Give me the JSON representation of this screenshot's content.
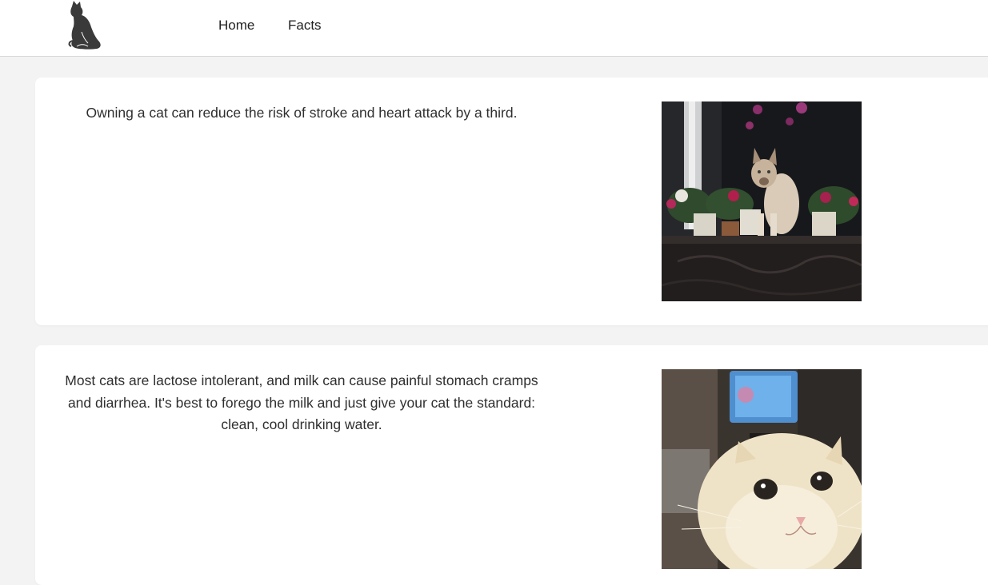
{
  "nav": {
    "home_label": "Home",
    "facts_label": "Facts",
    "logo_icon": "cat-silhouette-icon"
  },
  "facts": [
    {
      "text": "Owning a cat can reduce the risk of stroke and heart attack by a third.",
      "image": "siamese-cat-on-sofa-photo"
    },
    {
      "text": "Most cats are lactose intolerant, and milk can cause painful stomach cramps and diarrhea. It's best to forego the milk and just give your cat the standard: clean, cool drinking water.",
      "image": "cream-cat-closeup-photo"
    }
  ],
  "colors": {
    "page_background": "#f3f3f3",
    "card_background": "#ffffff",
    "text": "#2f2f2f"
  }
}
